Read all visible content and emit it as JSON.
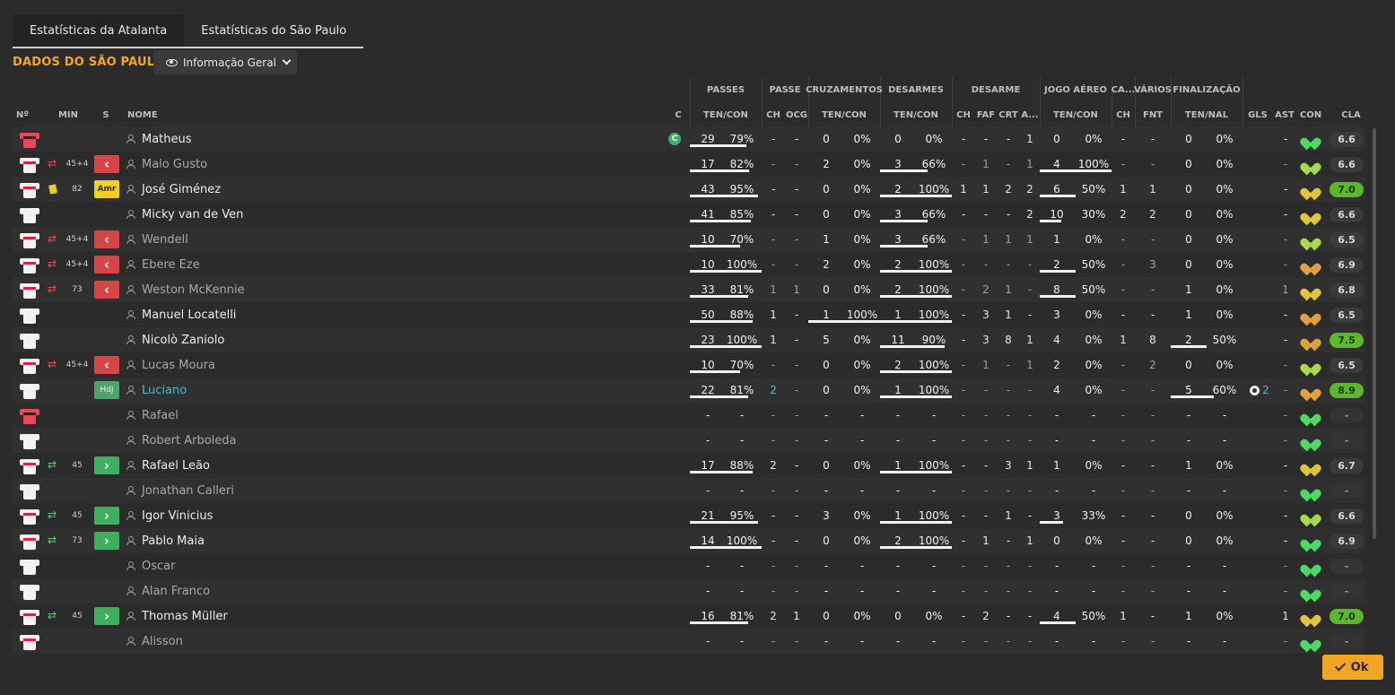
{
  "tabs": [
    {
      "label": "Estatísticas da Atalanta",
      "active": true
    },
    {
      "label": "Estatísticas do São Paulo",
      "active": false
    }
  ],
  "section_title": "DADOS DO SÃO PAULO",
  "view_selector": {
    "label": "Informação Geral",
    "icon": "eye-icon"
  },
  "group_headers": [
    "PASSES",
    "PASSE",
    "CRUZAMENTOS",
    "DESARMES",
    "DESARME",
    "JOGO AÉREO",
    "CA...",
    "VÁRIOS",
    "FINALIZAÇÃO"
  ],
  "columns": {
    "num": "Nº",
    "min": "MIN",
    "s": "S",
    "name": "NOME",
    "c": "C",
    "passes": "TEN/CON",
    "passe_ch": "CH",
    "passe_ocg": "OCG",
    "cruz": "TEN/CON",
    "desarmes": "TEN/CON",
    "des_ch": "CH",
    "des_faf": "FAF",
    "des_crt": "CRT",
    "des_a": "A...",
    "aereo": "TEN/CON",
    "ca_ch": "CH",
    "varios_fnt": "FNT",
    "final": "TEN/NAL",
    "gls": "GLS",
    "ast": "AST",
    "con": "CON",
    "cla": "CLA"
  },
  "colors": {
    "accent": "#f5a623",
    "sub_out": "#d64545",
    "sub_in": "#3fae5f",
    "rating_good": "#5cb82a",
    "link": "#4fb7d6"
  },
  "players": [
    {
      "name": "Matheus",
      "kit": "gk",
      "captain": "C",
      "sub": "",
      "min": "",
      "badge": "",
      "dim": false,
      "link": false,
      "p": [
        "29",
        "79%"
      ],
      "pc": [
        "-",
        "-"
      ],
      "cr": [
        "0",
        "0%"
      ],
      "ds": [
        "0",
        "0%"
      ],
      "de": [
        "-",
        "-",
        "-",
        "1"
      ],
      "ja": [
        "0",
        "0%"
      ],
      "ca": "-",
      "fnt": "-",
      "fi": [
        "0",
        "0%"
      ],
      "gls": "",
      "ast": "-",
      "heart": "green",
      "cla": "6.6",
      "good": false,
      "pb": 0.79,
      "db": 0,
      "jb": 0,
      "fb": 0
    },
    {
      "name": "Malo Gusto",
      "kit": "out",
      "sub": "out",
      "min": "45+4",
      "badge": "out",
      "dim": true,
      "link": false,
      "p": [
        "17",
        "82%"
      ],
      "pc": [
        "-",
        "-"
      ],
      "cr": [
        "2",
        "0%"
      ],
      "ds": [
        "3",
        "66%"
      ],
      "de": [
        "-",
        "1",
        "-",
        "1"
      ],
      "ja": [
        "4",
        "100%"
      ],
      "ca": "-",
      "fnt": "-",
      "fi": [
        "0",
        "0%"
      ],
      "gls": "",
      "ast": "-",
      "heart": "lime",
      "cla": "6.6",
      "good": false,
      "pb": 0.82,
      "db": 0.66,
      "jb": 1,
      "fb": 0
    },
    {
      "name": "José Giménez",
      "kit": "out",
      "sub": "card",
      "min": "82",
      "badge": "amr",
      "dim": false,
      "link": false,
      "p": [
        "43",
        "95%"
      ],
      "pc": [
        "-",
        "-"
      ],
      "cr": [
        "0",
        "0%"
      ],
      "ds": [
        "2",
        "100%"
      ],
      "de": [
        "1",
        "1",
        "2",
        "2"
      ],
      "ja": [
        "6",
        "50%"
      ],
      "ca": "1",
      "fnt": "1",
      "fi": [
        "0",
        "0%"
      ],
      "gls": "",
      "ast": "-",
      "heart": "yellow",
      "cla": "7.0",
      "good": true,
      "pb": 0.95,
      "db": 1,
      "jb": 0.5,
      "fb": 0
    },
    {
      "name": "Micky van de Ven",
      "kit": "plain",
      "sub": "",
      "min": "",
      "badge": "",
      "dim": false,
      "link": false,
      "p": [
        "41",
        "85%"
      ],
      "pc": [
        "-",
        "-"
      ],
      "cr": [
        "0",
        "0%"
      ],
      "ds": [
        "3",
        "66%"
      ],
      "de": [
        "-",
        "-",
        "-",
        "2"
      ],
      "ja": [
        "10",
        "30%"
      ],
      "ca": "2",
      "fnt": "2",
      "fi": [
        "0",
        "0%"
      ],
      "gls": "",
      "ast": "-",
      "heart": "yellow",
      "cla": "6.6",
      "good": false,
      "pb": 0.85,
      "db": 0.66,
      "jb": 0.3,
      "fb": 0
    },
    {
      "name": "Wendell",
      "kit": "out",
      "sub": "out",
      "min": "45+4",
      "badge": "out",
      "dim": true,
      "link": false,
      "p": [
        "10",
        "70%"
      ],
      "pc": [
        "-",
        "-"
      ],
      "cr": [
        "1",
        "0%"
      ],
      "ds": [
        "3",
        "66%"
      ],
      "de": [
        "-",
        "1",
        "1",
        "1"
      ],
      "ja": [
        "1",
        "0%"
      ],
      "ca": "-",
      "fnt": "-",
      "fi": [
        "0",
        "0%"
      ],
      "gls": "",
      "ast": "-",
      "heart": "lime",
      "cla": "6.5",
      "good": false,
      "pb": 0.7,
      "db": 0.66,
      "jb": 0,
      "fb": 0
    },
    {
      "name": "Ebere Eze",
      "kit": "out",
      "sub": "out",
      "min": "45+4",
      "badge": "out",
      "dim": true,
      "link": false,
      "p": [
        "10",
        "100%"
      ],
      "pc": [
        "-",
        "-"
      ],
      "cr": [
        "2",
        "0%"
      ],
      "ds": [
        "2",
        "100%"
      ],
      "de": [
        "-",
        "-",
        "-",
        "-"
      ],
      "ja": [
        "2",
        "50%"
      ],
      "ca": "-",
      "fnt": "3",
      "fi": [
        "0",
        "0%"
      ],
      "gls": "",
      "ast": "-",
      "heart": "orange",
      "cla": "6.9",
      "good": false,
      "pb": 1,
      "db": 1,
      "jb": 0.5,
      "fb": 0
    },
    {
      "name": "Weston McKennie",
      "kit": "out",
      "sub": "out",
      "min": "73",
      "badge": "out",
      "dim": true,
      "link": false,
      "p": [
        "33",
        "81%"
      ],
      "pc": [
        "1",
        "1"
      ],
      "cr": [
        "0",
        "0%"
      ],
      "ds": [
        "2",
        "100%"
      ],
      "de": [
        "-",
        "2",
        "1",
        "-"
      ],
      "ja": [
        "8",
        "50%"
      ],
      "ca": "-",
      "fnt": "-",
      "fi": [
        "1",
        "0%"
      ],
      "gls": "",
      "ast": "1",
      "heart": "yellow",
      "cla": "6.8",
      "good": false,
      "pb": 0.81,
      "db": 1,
      "jb": 0.5,
      "fb": 0
    },
    {
      "name": "Manuel Locatelli",
      "kit": "plain",
      "sub": "",
      "min": "",
      "badge": "",
      "dim": false,
      "link": false,
      "p": [
        "50",
        "88%"
      ],
      "pc": [
        "1",
        "-"
      ],
      "cr": [
        "1",
        "100%"
      ],
      "ds": [
        "1",
        "100%"
      ],
      "de": [
        "-",
        "3",
        "1",
        "-"
      ],
      "ja": [
        "3",
        "0%"
      ],
      "ca": "-",
      "fnt": "-",
      "fi": [
        "1",
        "0%"
      ],
      "gls": "",
      "ast": "-",
      "heart": "orange",
      "cla": "6.5",
      "good": false,
      "pb": 0.88,
      "db": 1,
      "jb": 0,
      "fb": 0,
      "cb": 1
    },
    {
      "name": "Nicolò Zaniolo",
      "kit": "plain",
      "sub": "",
      "min": "",
      "badge": "",
      "dim": false,
      "link": false,
      "p": [
        "23",
        "100%"
      ],
      "pc": [
        "1",
        "-"
      ],
      "cr": [
        "5",
        "0%"
      ],
      "ds": [
        "11",
        "90%"
      ],
      "de": [
        "-",
        "3",
        "8",
        "1"
      ],
      "ja": [
        "4",
        "0%"
      ],
      "ca": "1",
      "fnt": "8",
      "fi": [
        "2",
        "50%"
      ],
      "gls": "",
      "ast": "-",
      "heart": "orange",
      "cla": "7.5",
      "good": true,
      "pb": 1,
      "db": 0.9,
      "jb": 0,
      "fb": 0.5
    },
    {
      "name": "Lucas Moura",
      "kit": "out",
      "sub": "out",
      "min": "45+4",
      "badge": "out",
      "dim": true,
      "link": false,
      "p": [
        "10",
        "70%"
      ],
      "pc": [
        "-",
        "-"
      ],
      "cr": [
        "0",
        "0%"
      ],
      "ds": [
        "2",
        "100%"
      ],
      "de": [
        "-",
        "1",
        "-",
        "1"
      ],
      "ja": [
        "2",
        "0%"
      ],
      "ca": "-",
      "fnt": "2",
      "fi": [
        "0",
        "0%"
      ],
      "gls": "",
      "ast": "-",
      "heart": "lime",
      "cla": "6.5",
      "good": false,
      "pb": 0.7,
      "db": 1,
      "jb": 0,
      "fb": 0
    },
    {
      "name": "Luciano",
      "kit": "plain",
      "sub": "",
      "min": "",
      "badge": "hdj",
      "dim": false,
      "link": true,
      "p": [
        "22",
        "81%"
      ],
      "pc": [
        "2",
        "-"
      ],
      "cr": [
        "0",
        "0%"
      ],
      "ds": [
        "1",
        "100%"
      ],
      "de": [
        "-",
        "-",
        "-",
        "-"
      ],
      "ja": [
        "4",
        "0%"
      ],
      "ca": "-",
      "fnt": "-",
      "fi": [
        "5",
        "60%"
      ],
      "gls": "2",
      "ast": "-",
      "heart": "orange",
      "cla": "8.9",
      "good": true,
      "pb": 0.81,
      "db": 1,
      "jb": 0,
      "fb": 0.6
    },
    {
      "name": "Rafael",
      "kit": "gk",
      "sub": "",
      "min": "",
      "badge": "",
      "dim": true,
      "link": false,
      "p": [
        "-",
        "-"
      ],
      "pc": [
        "-",
        "-"
      ],
      "cr": [
        "-",
        "-"
      ],
      "ds": [
        "-",
        "-"
      ],
      "de": [
        "-",
        "-",
        "-",
        "-"
      ],
      "ja": [
        "-",
        "-"
      ],
      "ca": "-",
      "fnt": "-",
      "fi": [
        "-",
        "-"
      ],
      "gls": "",
      "ast": "-",
      "heart": "green",
      "cla": "-",
      "good": false,
      "pb": 0,
      "db": 0,
      "jb": 0,
      "fb": 0
    },
    {
      "name": "Robert Arboleda",
      "kit": "plain",
      "sub": "",
      "min": "",
      "badge": "",
      "dim": true,
      "link": false,
      "p": [
        "-",
        "-"
      ],
      "pc": [
        "-",
        "-"
      ],
      "cr": [
        "-",
        "-"
      ],
      "ds": [
        "-",
        "-"
      ],
      "de": [
        "-",
        "-",
        "-",
        "-"
      ],
      "ja": [
        "-",
        "-"
      ],
      "ca": "-",
      "fnt": "-",
      "fi": [
        "-",
        "-"
      ],
      "gls": "",
      "ast": "-",
      "heart": "green",
      "cla": "-",
      "good": false,
      "pb": 0,
      "db": 0,
      "jb": 0,
      "fb": 0
    },
    {
      "name": "Rafael Leão",
      "kit": "out",
      "sub": "in",
      "min": "45",
      "badge": "in",
      "dim": false,
      "link": false,
      "p": [
        "17",
        "88%"
      ],
      "pc": [
        "2",
        "-"
      ],
      "cr": [
        "0",
        "0%"
      ],
      "ds": [
        "1",
        "100%"
      ],
      "de": [
        "-",
        "-",
        "3",
        "1"
      ],
      "ja": [
        "1",
        "0%"
      ],
      "ca": "-",
      "fnt": "-",
      "fi": [
        "1",
        "0%"
      ],
      "gls": "",
      "ast": "-",
      "heart": "yellow",
      "cla": "6.7",
      "good": false,
      "pb": 0.88,
      "db": 1,
      "jb": 0,
      "fb": 0
    },
    {
      "name": "Jonathan Calleri",
      "kit": "plain",
      "sub": "",
      "min": "",
      "badge": "",
      "dim": true,
      "link": false,
      "p": [
        "-",
        "-"
      ],
      "pc": [
        "-",
        "-"
      ],
      "cr": [
        "-",
        "-"
      ],
      "ds": [
        "-",
        "-"
      ],
      "de": [
        "-",
        "-",
        "-",
        "-"
      ],
      "ja": [
        "-",
        "-"
      ],
      "ca": "-",
      "fnt": "-",
      "fi": [
        "-",
        "-"
      ],
      "gls": "",
      "ast": "-",
      "heart": "green",
      "cla": "-",
      "good": false,
      "pb": 0,
      "db": 0,
      "jb": 0,
      "fb": 0
    },
    {
      "name": "Igor Vinicius",
      "kit": "out",
      "sub": "in",
      "min": "45",
      "badge": "in",
      "dim": false,
      "link": false,
      "p": [
        "21",
        "95%"
      ],
      "pc": [
        "-",
        "-"
      ],
      "cr": [
        "3",
        "0%"
      ],
      "ds": [
        "1",
        "100%"
      ],
      "de": [
        "-",
        "-",
        "1",
        "-"
      ],
      "ja": [
        "3",
        "33%"
      ],
      "ca": "-",
      "fnt": "-",
      "fi": [
        "0",
        "0%"
      ],
      "gls": "",
      "ast": "-",
      "heart": "lime",
      "cla": "6.6",
      "good": false,
      "pb": 0.95,
      "db": 1,
      "jb": 0.33,
      "fb": 0
    },
    {
      "name": "Pablo Maia",
      "kit": "out",
      "sub": "in",
      "min": "73",
      "badge": "in",
      "dim": false,
      "link": false,
      "p": [
        "14",
        "100%"
      ],
      "pc": [
        "-",
        "-"
      ],
      "cr": [
        "0",
        "0%"
      ],
      "ds": [
        "2",
        "100%"
      ],
      "de": [
        "-",
        "1",
        "-",
        "1"
      ],
      "ja": [
        "0",
        "0%"
      ],
      "ca": "-",
      "fnt": "-",
      "fi": [
        "0",
        "0%"
      ],
      "gls": "",
      "ast": "-",
      "heart": "green",
      "cla": "6.9",
      "good": false,
      "pb": 1,
      "db": 1,
      "jb": 0,
      "fb": 0
    },
    {
      "name": "Oscar",
      "kit": "plain",
      "sub": "",
      "min": "",
      "badge": "",
      "dim": true,
      "link": false,
      "p": [
        "-",
        "-"
      ],
      "pc": [
        "-",
        "-"
      ],
      "cr": [
        "-",
        "-"
      ],
      "ds": [
        "-",
        "-"
      ],
      "de": [
        "-",
        "-",
        "-",
        "-"
      ],
      "ja": [
        "-",
        "-"
      ],
      "ca": "-",
      "fnt": "-",
      "fi": [
        "-",
        "-"
      ],
      "gls": "",
      "ast": "-",
      "heart": "green",
      "cla": "-",
      "good": false,
      "pb": 0,
      "db": 0,
      "jb": 0,
      "fb": 0
    },
    {
      "name": "Alan Franco",
      "kit": "plain",
      "sub": "",
      "min": "",
      "badge": "",
      "dim": true,
      "link": false,
      "p": [
        "-",
        "-"
      ],
      "pc": [
        "-",
        "-"
      ],
      "cr": [
        "-",
        "-"
      ],
      "ds": [
        "-",
        "-"
      ],
      "de": [
        "-",
        "-",
        "-",
        "-"
      ],
      "ja": [
        "-",
        "-"
      ],
      "ca": "-",
      "fnt": "-",
      "fi": [
        "-",
        "-"
      ],
      "gls": "",
      "ast": "-",
      "heart": "green",
      "cla": "-",
      "good": false,
      "pb": 0,
      "db": 0,
      "jb": 0,
      "fb": 0
    },
    {
      "name": "Thomas Müller",
      "kit": "out",
      "sub": "in",
      "min": "45",
      "badge": "in",
      "dim": false,
      "link": false,
      "p": [
        "16",
        "81%"
      ],
      "pc": [
        "2",
        "1"
      ],
      "cr": [
        "0",
        "0%"
      ],
      "ds": [
        "0",
        "0%"
      ],
      "de": [
        "-",
        "2",
        "-",
        "-"
      ],
      "ja": [
        "4",
        "50%"
      ],
      "ca": "1",
      "fnt": "-",
      "fi": [
        "1",
        "0%"
      ],
      "gls": "",
      "ast": "1",
      "heart": "yellow",
      "cla": "7.0",
      "good": true,
      "pb": 0.81,
      "db": 0,
      "jb": 0.5,
      "fb": 0
    },
    {
      "name": "Alisson",
      "kit": "out",
      "sub": "",
      "min": "",
      "badge": "",
      "dim": true,
      "link": false,
      "p": [
        "-",
        "-"
      ],
      "pc": [
        "-",
        "-"
      ],
      "cr": [
        "-",
        "-"
      ],
      "ds": [
        "-",
        "-"
      ],
      "de": [
        "-",
        "-",
        "-",
        "-"
      ],
      "ja": [
        "-",
        "-"
      ],
      "ca": "-",
      "fnt": "-",
      "fi": [
        "-",
        "-"
      ],
      "gls": "",
      "ast": "-",
      "heart": "green",
      "cla": "-",
      "good": false,
      "pb": 0,
      "db": 0,
      "jb": 0,
      "fb": 0
    }
  ],
  "badges": {
    "amr": "Amr",
    "hdj": "HdJ",
    "out": "‹",
    "in": "›"
  },
  "ok_label": "Ok"
}
